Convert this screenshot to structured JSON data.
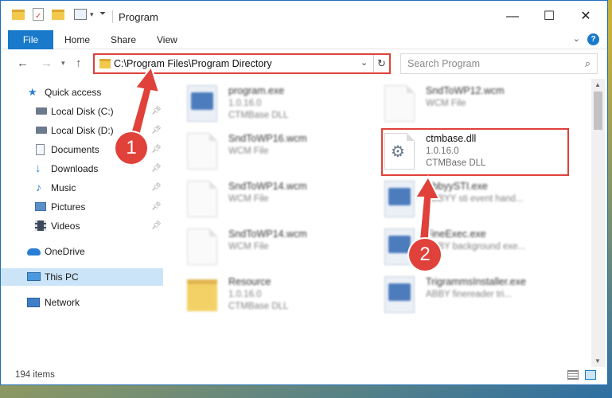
{
  "window": {
    "title": "Program",
    "controls": {
      "minimize": "—",
      "maximize": "☐",
      "close": "✕"
    }
  },
  "ribbon": {
    "file_tab": "File",
    "tabs": [
      "Home",
      "Share",
      "View"
    ],
    "expand": "⌄",
    "help": "?"
  },
  "address": {
    "path": "C:\\Program Files\\Program Directory",
    "search_placeholder": "Search Program"
  },
  "sidebar": {
    "items": [
      {
        "label": "Quick access",
        "icon": "star-icon",
        "pinned": false
      },
      {
        "label": "Local Disk (C:)",
        "icon": "drive-icon",
        "pinned": true
      },
      {
        "label": "Local Disk (D:)",
        "icon": "drive-icon",
        "pinned": true
      },
      {
        "label": "Documents",
        "icon": "documents-icon",
        "pinned": true
      },
      {
        "label": "Downloads",
        "icon": "download-icon",
        "pinned": true
      },
      {
        "label": "Music",
        "icon": "music-icon",
        "pinned": true
      },
      {
        "label": "Pictures",
        "icon": "pictures-icon",
        "pinned": true
      },
      {
        "label": "Videos",
        "icon": "videos-icon",
        "pinned": true
      },
      {
        "label": "OneDrive",
        "icon": "cloud-icon",
        "pinned": false
      },
      {
        "label": "This PC",
        "icon": "computer-icon",
        "pinned": false,
        "selected": true
      },
      {
        "label": "Network",
        "icon": "network-icon",
        "pinned": false
      }
    ]
  },
  "files": [
    {
      "name": "program.exe",
      "line1": "1.0.16.0",
      "line2": "CTMBase DLL",
      "kind": "exe"
    },
    {
      "name": "SndToWP12.wcm",
      "line1": "WCM File",
      "line2": "",
      "kind": "doc"
    },
    {
      "name": "SndToWP16.wcm",
      "line1": "WCM File",
      "line2": "",
      "kind": "doc"
    },
    {
      "name": "ctmbase.dll",
      "line1": "1.0.16.0",
      "line2": "CTMBase DLL",
      "kind": "dll"
    },
    {
      "name": "SndToWP14.wcm",
      "line1": "WCM File",
      "line2": "",
      "kind": "doc"
    },
    {
      "name": "AbbyySTI.exe",
      "line1": "ABBYY sti event hand...",
      "line2": "",
      "kind": "exe"
    },
    {
      "name": "SndToWP14.wcm",
      "line1": "WCM File",
      "line2": "",
      "kind": "doc"
    },
    {
      "name": "FineExec.exe",
      "line1": "ABBY background exe...",
      "line2": "",
      "kind": "exe"
    },
    {
      "name": "Resource",
      "line1": "1.0.16.0",
      "line2": "CTMBase DLL",
      "kind": "folder"
    },
    {
      "name": "TrigrammsInstaller.exe",
      "line1": "ABBY finereader tri...",
      "line2": "",
      "kind": "exe"
    }
  ],
  "status": {
    "item_count": "194 items"
  },
  "annotations": {
    "step1": "1",
    "step2": "2"
  },
  "colors": {
    "accent": "#1979ca",
    "highlight": "#e0413a",
    "selected": "#cce4f7"
  }
}
